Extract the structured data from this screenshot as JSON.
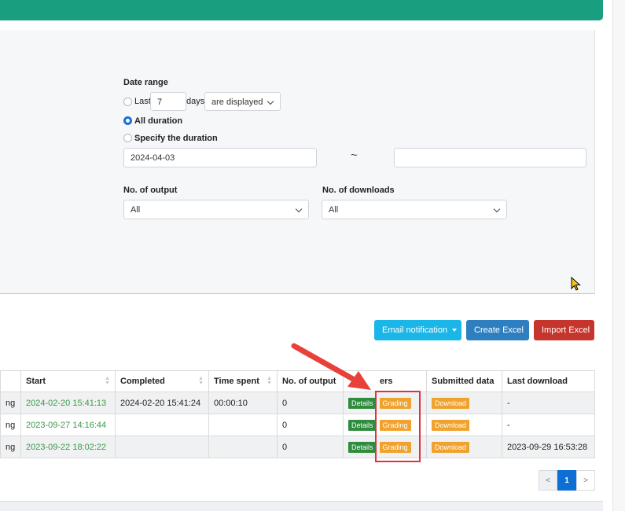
{
  "filters": {
    "date_range_label": "Date range",
    "last_label": "Last",
    "last_value": "7",
    "days_label": "days",
    "display_select": "are displayed",
    "all_duration_label": "All duration",
    "specify_label": "Specify the duration",
    "date_from": "2024-04-03",
    "date_to": "",
    "tilde": "~",
    "output_label": "No. of output",
    "output_value": "All",
    "downloads_label": "No. of downloads",
    "downloads_value": "All"
  },
  "actions": {
    "email_label": "Email notification",
    "create_excel_label": "Create Excel",
    "import_excel_label": "Import Excel"
  },
  "table": {
    "columns": [
      "",
      "Start",
      "Completed",
      "Time spent",
      "No. of output",
      "ers",
      "Submitted data",
      "Last download"
    ],
    "rows": [
      {
        "status": "ng",
        "start": "2024-02-20 15:41:13",
        "completed": "2024-02-20 15:41:24",
        "time_spent": "00:00:10",
        "outputs": "0",
        "details": "Details",
        "grading": "Grading",
        "submitted": "Download",
        "last_download": "-"
      },
      {
        "status": "ng",
        "start": "2023-09-27 14:16:44",
        "completed": "",
        "time_spent": "",
        "outputs": "0",
        "details": "Details",
        "grading": "Grading",
        "submitted": "Download",
        "last_download": "-"
      },
      {
        "status": "ng",
        "start": "2023-09-22 18:02:22",
        "completed": "",
        "time_spent": "",
        "outputs": "0",
        "details": "Details",
        "grading": "Grading",
        "submitted": "Download",
        "last_download": "2023-09-29 16:53:28"
      }
    ]
  },
  "pagination": {
    "prev": "<",
    "current": "1",
    "next": ">"
  },
  "colors": {
    "header": "#1a9e80",
    "highlight": "#e1323c",
    "grading": "#f0a22e",
    "details": "#2f8b3d"
  }
}
